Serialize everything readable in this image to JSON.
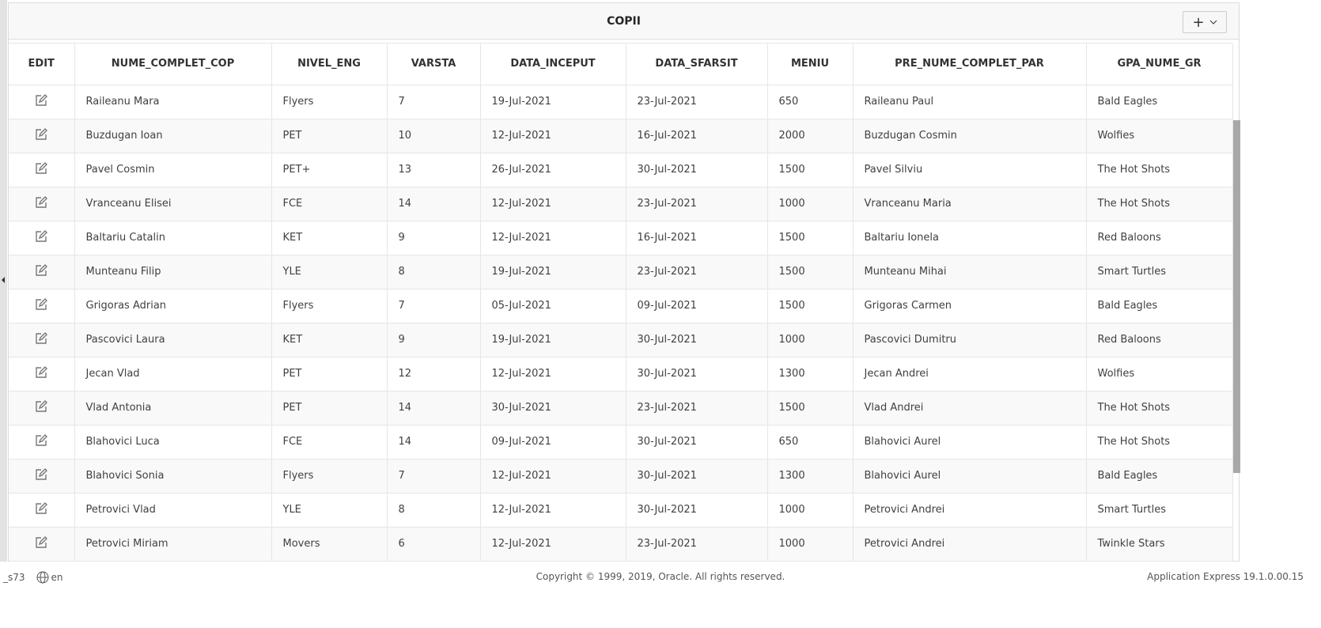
{
  "region": {
    "title": "COPII",
    "add_icon": "plus-icon",
    "menu_icon": "chevron-down-icon"
  },
  "columns": [
    "EDIT",
    "NUME_COMPLET_COP",
    "NIVEL_ENG",
    "VARSTA",
    "DATA_INCEPUT",
    "DATA_SFARSIT",
    "MENIU",
    "PRE_NUME_COMPLET_PAR",
    "GPA_NUME_GR"
  ],
  "rows": [
    [
      "Raileanu Mara",
      "Flyers",
      "7",
      "19-Jul-2021",
      "23-Jul-2021",
      "650",
      "Raileanu Paul",
      "Bald Eagles"
    ],
    [
      "Buzdugan Ioan",
      "PET",
      "10",
      "12-Jul-2021",
      "16-Jul-2021",
      "2000",
      "Buzdugan Cosmin",
      "Wolfies"
    ],
    [
      "Pavel Cosmin",
      "PET+",
      "13",
      "26-Jul-2021",
      "30-Jul-2021",
      "1500",
      "Pavel Silviu",
      "The Hot Shots"
    ],
    [
      "Vranceanu Elisei",
      "FCE",
      "14",
      "12-Jul-2021",
      "23-Jul-2021",
      "1000",
      "Vranceanu Maria",
      "The Hot Shots"
    ],
    [
      "Baltariu Catalin",
      "KET",
      "9",
      "12-Jul-2021",
      "16-Jul-2021",
      "1500",
      "Baltariu Ionela",
      "Red Baloons"
    ],
    [
      "Munteanu Filip",
      "YLE",
      "8",
      "19-Jul-2021",
      "23-Jul-2021",
      "1500",
      "Munteanu Mihai",
      "Smart Turtles"
    ],
    [
      "Grigoras Adrian",
      "Flyers",
      "7",
      "05-Jul-2021",
      "09-Jul-2021",
      "1500",
      "Grigoras Carmen",
      "Bald Eagles"
    ],
    [
      "Pascovici Laura",
      "KET",
      "9",
      "19-Jul-2021",
      "30-Jul-2021",
      "1000",
      "Pascovici Dumitru",
      "Red Baloons"
    ],
    [
      "Jecan Vlad",
      "PET",
      "12",
      "12-Jul-2021",
      "30-Jul-2021",
      "1300",
      "Jecan Andrei",
      "Wolfies"
    ],
    [
      "Vlad Antonia",
      "PET",
      "14",
      "30-Jul-2021",
      "23-Jul-2021",
      "1500",
      "Vlad Andrei",
      "The Hot Shots"
    ],
    [
      "Blahovici Luca",
      "FCE",
      "14",
      "09-Jul-2021",
      "30-Jul-2021",
      "650",
      "Blahovici Aurel",
      "The Hot Shots"
    ],
    [
      "Blahovici Sonia",
      "Flyers",
      "7",
      "12-Jul-2021",
      "30-Jul-2021",
      "1300",
      "Blahovici Aurel",
      "Bald Eagles"
    ],
    [
      "Petrovici Vlad",
      "YLE",
      "8",
      "12-Jul-2021",
      "30-Jul-2021",
      "1000",
      "Petrovici Andrei",
      "Smart Turtles"
    ],
    [
      "Petrovici Miriam",
      "Movers",
      "6",
      "12-Jul-2021",
      "23-Jul-2021",
      "1000",
      "Petrovici Andrei",
      "Twinkle Stars"
    ]
  ],
  "footer": {
    "session": "_s73",
    "language": "en",
    "copyright": "Copyright © 1999, 2019, Oracle. All rights reserved.",
    "version": "Application Express 19.1.0.00.15"
  }
}
